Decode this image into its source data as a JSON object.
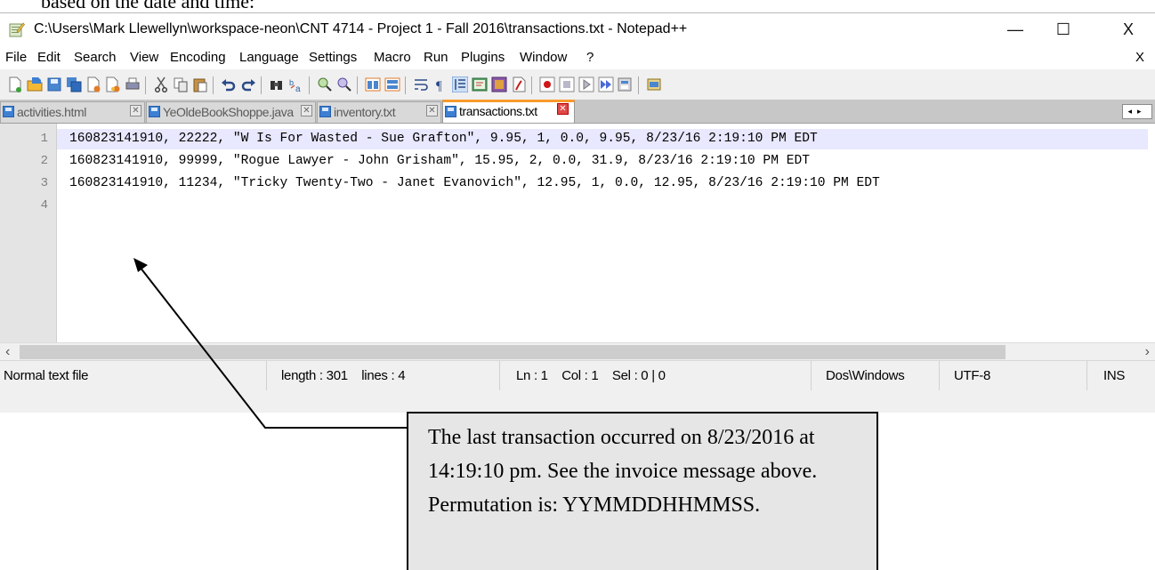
{
  "document": {
    "header_text": "based on the date and time:"
  },
  "window": {
    "title": "C:\\Users\\Mark Llewellyn\\workspace-neon\\CNT 4714 - Project 1 - Fall 2016\\transactions.txt - Notepad++",
    "controls": {
      "minimize": "—",
      "maximize": "☐",
      "close": "X"
    }
  },
  "menubar": {
    "items": [
      "File",
      "Edit",
      "Search",
      "View",
      "Encoding",
      "Language",
      "Settings",
      "Macro",
      "Run",
      "Plugins",
      "Window",
      "?"
    ],
    "close_label": "X"
  },
  "toolbar": {
    "icons": [
      "new-file-icon",
      "open-file-icon",
      "save-icon",
      "save-all-icon",
      "close-file-icon",
      "close-all-icon",
      "print-icon",
      "cut-icon",
      "copy-icon",
      "paste-icon",
      "undo-icon",
      "redo-icon",
      "find-icon",
      "replace-icon",
      "zoom-in-icon",
      "zoom-out-icon",
      "sync-vertical-icon",
      "sync-horizontal-icon",
      "word-wrap-icon",
      "show-all-chars-icon",
      "indent-guide-icon",
      "doc-map-icon",
      "function-list-icon",
      "folder-workspace-icon",
      "record-macro-icon",
      "stop-macro-icon",
      "play-macro-icon",
      "run-macro-multiple-icon",
      "save-macro-icon",
      "plugin-icon"
    ]
  },
  "tabs": [
    {
      "label": "activities.html",
      "active": false
    },
    {
      "label": "YeOldeBookShoppe.java",
      "active": false
    },
    {
      "label": "inventory.txt",
      "active": false
    },
    {
      "label": "transactions.txt",
      "active": true
    }
  ],
  "tab_close_glyph": "✕",
  "editor": {
    "line_numbers": [
      "1",
      "2",
      "3",
      "4"
    ],
    "lines": [
      "160823141910, 22222, \"W Is For Wasted - Sue Grafton\", 9.95, 1, 0.0, 9.95, 8/23/16 2:19:10 PM EDT",
      "160823141910, 99999, \"Rogue Lawyer - John Grisham\", 15.95, 2, 0.0, 31.9, 8/23/16 2:19:10 PM EDT",
      "160823141910, 11234, \"Tricky Twenty-Two - Janet Evanovich\", 12.95, 1, 0.0, 12.95, 8/23/16 2:19:10 PM EDT",
      ""
    ]
  },
  "scrollbar": {
    "left_arrow": "‹",
    "right_arrow": "›"
  },
  "statusbar": {
    "file_type": "Normal text file",
    "length_lines": "length : 301    lines : 4",
    "position": "Ln : 1    Col : 1    Sel : 0 | 0",
    "eol": "Dos\\Windows",
    "encoding": "UTF-8",
    "mode": "INS"
  },
  "callout": {
    "text": "The last transaction occurred on 8/23/2016 at 14:19:10 pm.  See the invoice message above.  Permutation is: YYMMDDHHMMSS."
  },
  "colors": {
    "active_tab_accent": "#fa9a2c",
    "current_line": "#e8e8ff",
    "gutter": "#e4e4e4",
    "callout_bg": "#e6e6e6"
  }
}
